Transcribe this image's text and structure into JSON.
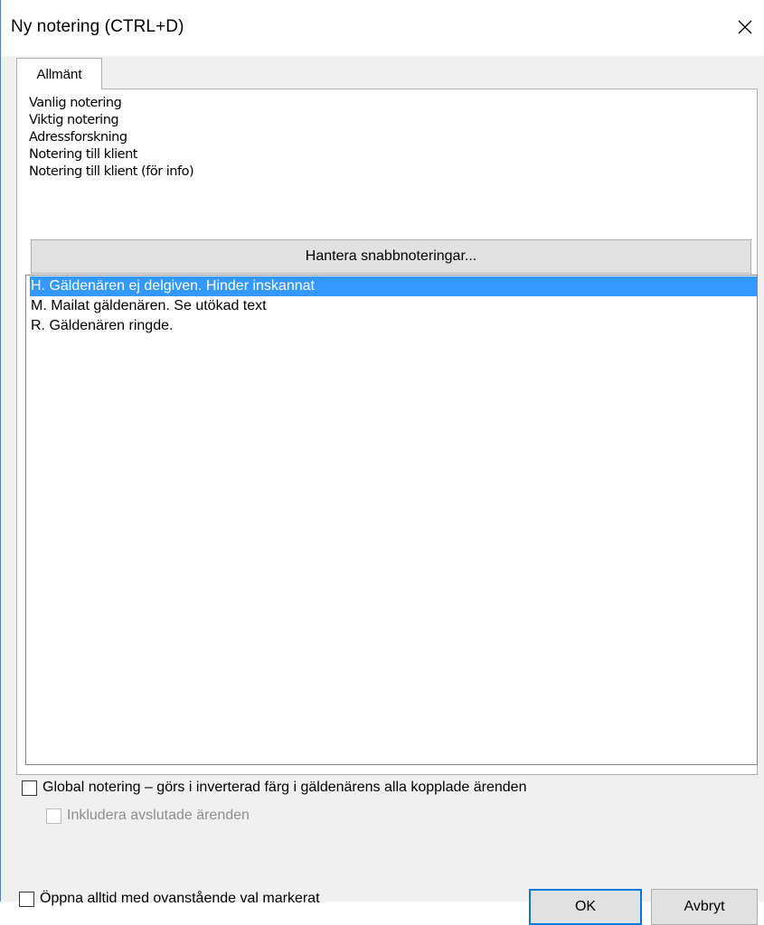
{
  "window": {
    "title": "Ny notering (CTRL+D)",
    "close_glyph": "✕",
    "background_glyph": "g"
  },
  "tabs": [
    {
      "label": "Allmänt"
    }
  ],
  "note_types": [
    "Vanlig notering",
    "Viktig notering",
    "Adressforskning",
    "Notering till klient",
    "Notering till klient (för info)"
  ],
  "manage_button_label": "Hantera snabbnoteringar...",
  "quick_notes": [
    {
      "text": "H. Gäldenären ej delgiven. Hinder inskannat",
      "selected": true
    },
    {
      "text": "M. Mailat gäldenären. Se utökad text",
      "selected": false
    },
    {
      "text": "R. Gäldenären ringde.",
      "selected": false
    }
  ],
  "options": {
    "global_note_label": "Global notering – görs i inverterad färg i gäldenärens alla kopplade ärenden",
    "include_closed_label": "Inkludera avslutade ärenden",
    "always_open_label": "Öppna alltid med ovanstående val markerat"
  },
  "buttons": {
    "ok_label": "OK",
    "cancel_label": "Avbryt"
  },
  "colors": {
    "selection": "#3399ff",
    "accent_border": "#0078d7"
  }
}
